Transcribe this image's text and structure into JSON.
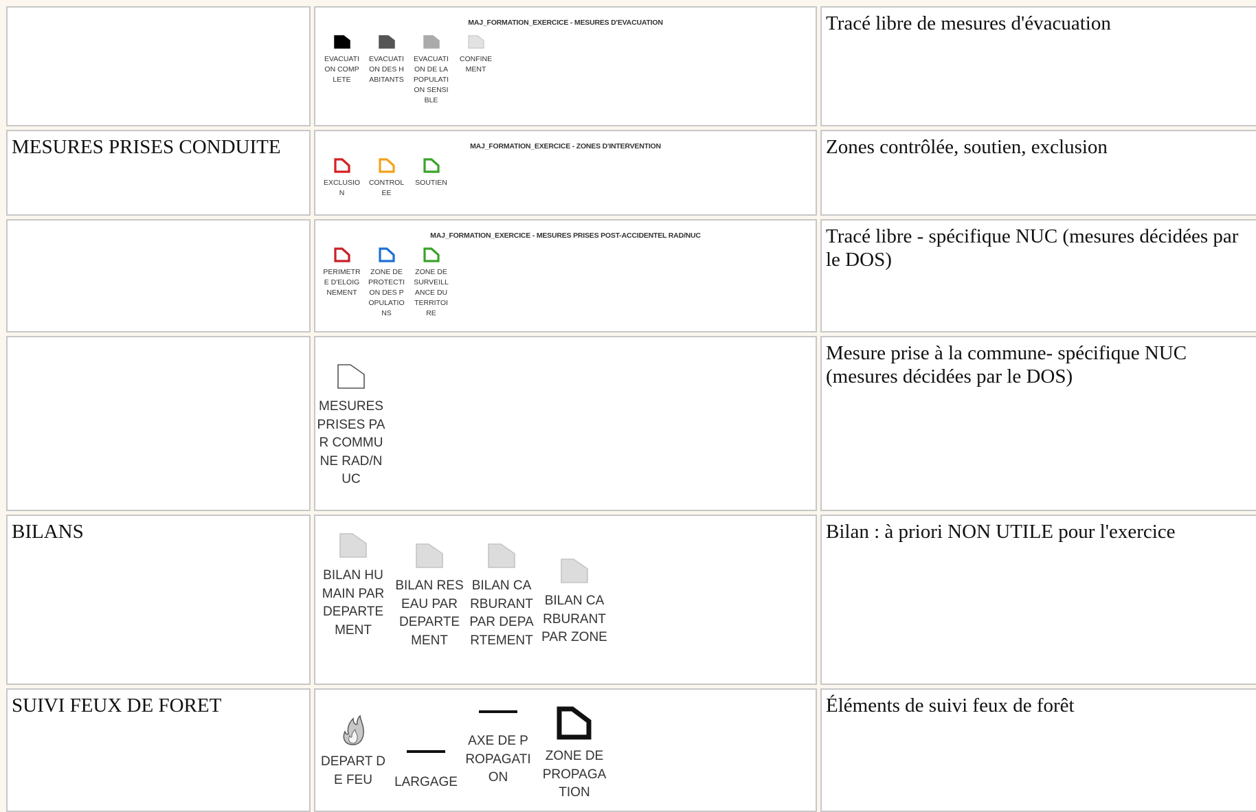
{
  "rows": [
    {
      "category": "",
      "legend_title": "MAJ_FORMATION_EXERCICE - MESURES D'EVACUATION",
      "items": [
        {
          "label": "EVACUATION COMPLETE",
          "icon": "evacuation-complete-icon",
          "color": "#000000"
        },
        {
          "label": "EVACUATION DES HABITANTS",
          "icon": "evacuation-habitants-icon",
          "color": "#555555"
        },
        {
          "label": "EVACUATION DE LA POPULATION SENSIBLE",
          "icon": "evacuation-population-sensible-icon",
          "color": "#aaaaaa"
        },
        {
          "label": "CONFINEMENT",
          "icon": "confinement-icon",
          "color": "#dddddd"
        }
      ],
      "description": "Tracé libre de mesures d'évacuation"
    },
    {
      "category": "MESURES PRISES CONDUITE",
      "legend_title": "MAJ_FORMATION_EXERCICE - ZONES D'INTERVENTION",
      "items": [
        {
          "label": "EXCLUSION",
          "icon": "zone-exclusion-icon",
          "color": "#d62020"
        },
        {
          "label": "CONTROLEE",
          "icon": "zone-controlee-icon",
          "color": "#f2a31b"
        },
        {
          "label": "SOUTIEN",
          "icon": "zone-soutien-icon",
          "color": "#3aa32a"
        }
      ],
      "description": "Zones contrôlée, soutien, exclusion"
    },
    {
      "category": "",
      "legend_title": "MAJ_FORMATION_EXERCICE - MESURES PRISES POST-ACCIDENTEL RAD/NUC",
      "items": [
        {
          "label": "PERIMETRE D'ELOIGNEMENT",
          "icon": "perimetre-eloignement-icon",
          "color": "#c8202a"
        },
        {
          "label": "ZONE DE PROTECTION DES POPULATIONS",
          "icon": "zone-protection-populations-icon",
          "color": "#1f6fd6"
        },
        {
          "label": "ZONE DE SURVEILLANCE DU TERRITOIRE",
          "icon": "zone-surveillance-territoire-icon",
          "color": "#3aa32a"
        }
      ],
      "description": "Tracé libre - spécifique NUC (mesures décidées par le DOS)"
    },
    {
      "category": "",
      "items": [
        {
          "label": "MESURES PRISES PAR COMMUNE RAD/NUC",
          "icon": "mesures-commune-icon",
          "color": "#ffffff"
        }
      ],
      "description": "Mesure prise à la commune- spécifique NUC (mesures décidées par le DOS)"
    },
    {
      "category": "BILANS",
      "items": [
        {
          "label": "BILAN HUMAIN PAR DEPARTEMENT",
          "icon": "bilan-humain-icon",
          "color": "#dcdcdc"
        },
        {
          "label": "BILAN RESEAU PAR DEPARTEMENT",
          "icon": "bilan-reseau-icon",
          "color": "#dcdcdc"
        },
        {
          "label": "BILAN CARBURANT PAR DEPARTEMENT",
          "icon": "bilan-carburant-departement-icon",
          "color": "#dcdcdc"
        },
        {
          "label": "BILAN CARBURANT PAR ZONE",
          "icon": "bilan-carburant-zone-icon",
          "color": "#dcdcdc"
        }
      ],
      "description": "Bilan : à priori NON UTILE pour l'exercice"
    },
    {
      "category": "SUIVI FEUX DE FORET",
      "items": [
        {
          "label": "DEPART DE FEU",
          "icon": "fire-icon",
          "color": "#888888"
        },
        {
          "label": "LARGAGE",
          "icon": "largage-line-icon",
          "color": "#111111"
        },
        {
          "label": "AXE DE PROPAGATION",
          "icon": "axe-propagation-line-icon",
          "color": "#111111"
        },
        {
          "label": "ZONE DE PROPAGATION",
          "icon": "zone-propagation-icon",
          "color": "#111111"
        }
      ],
      "description": "Éléments de suivi feux de forêt"
    }
  ]
}
